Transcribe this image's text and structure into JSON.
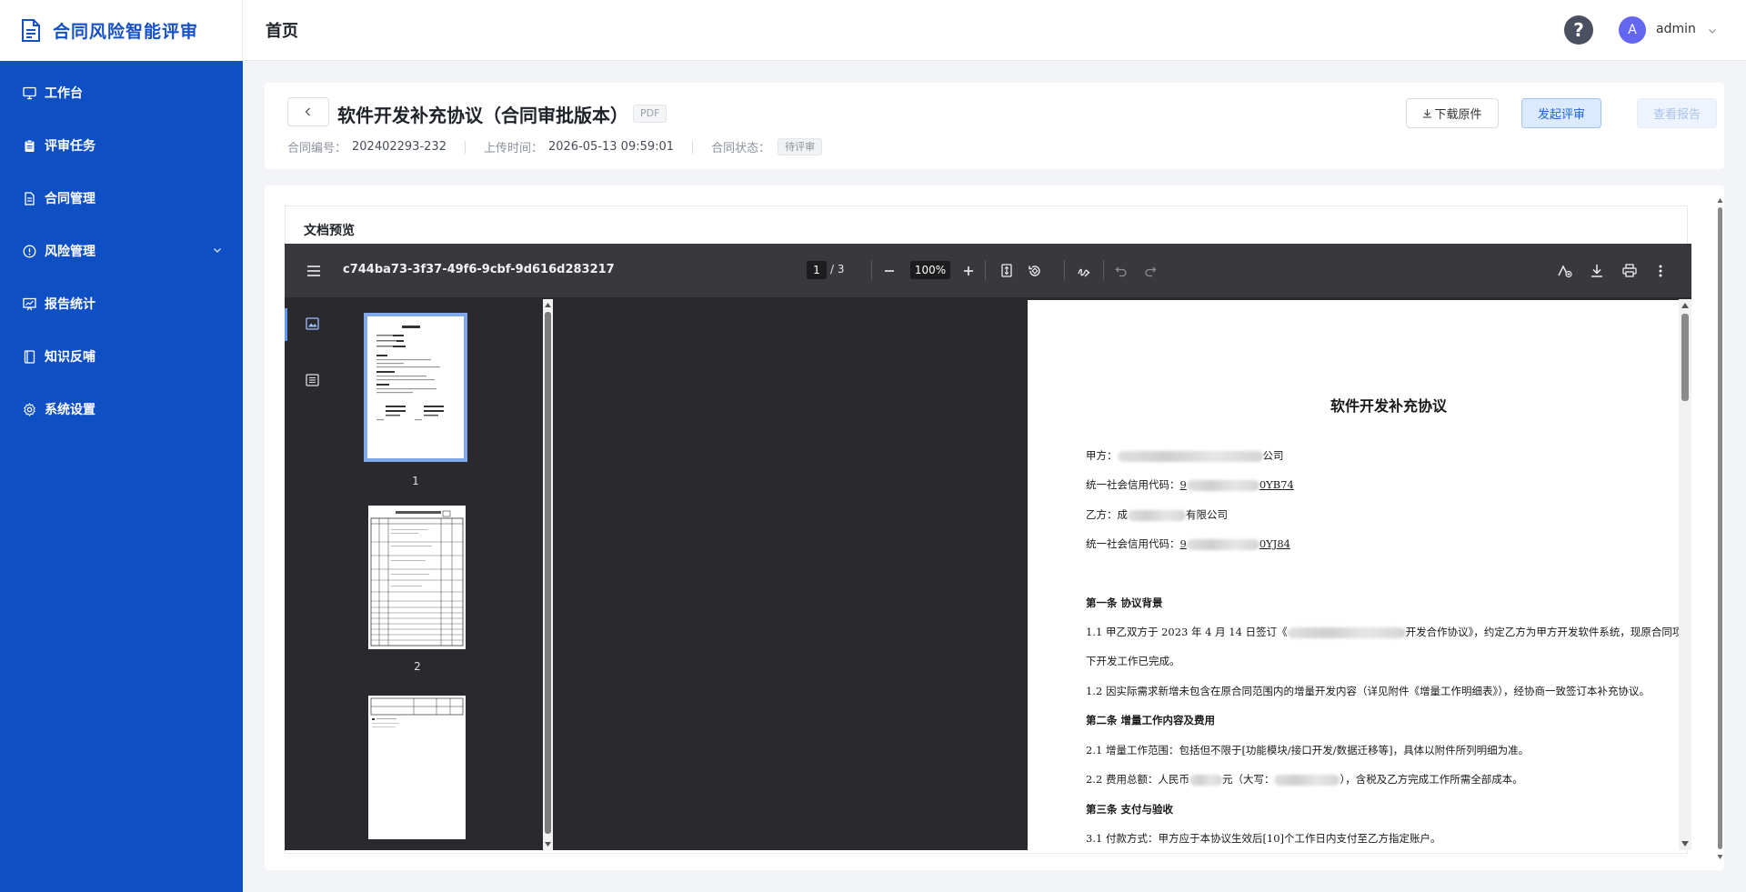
{
  "app": {
    "name": "合同风险智能评审"
  },
  "sidebar": {
    "items": [
      {
        "label": "工作台",
        "icon": "monitor-icon"
      },
      {
        "label": "评审任务",
        "icon": "clipboard-icon"
      },
      {
        "label": "合同管理",
        "icon": "document-icon"
      },
      {
        "label": "风险管理",
        "icon": "alert-circle-icon",
        "expandable": true
      },
      {
        "label": "报告统计",
        "icon": "chart-board-icon"
      },
      {
        "label": "知识反哺",
        "icon": "book-icon"
      },
      {
        "label": "系统设置",
        "icon": "gear-icon"
      }
    ]
  },
  "topbar": {
    "title": "首页",
    "avatar_letter": "A",
    "username": "admin"
  },
  "contract": {
    "title": "软件开发补充协议（合同审批版本）",
    "file_type": "PDF",
    "number_label": "合同编号：",
    "number": "202402293-232",
    "upload_label": "上传时间：",
    "upload_time": "2026-05-13 09:59:01",
    "status_label": "合同状态：",
    "status": "待评审",
    "download_label": "下载原件",
    "review_label": "发起评审",
    "report_label": "查看报告"
  },
  "preview": {
    "title": "文档预览"
  },
  "viewer": {
    "file_name": "c744ba73-3f37-49f6-9cbf-9d616d283217",
    "current_page": "1",
    "page_total": "/ 3",
    "zoom": "100%",
    "thumbnails": [
      "1",
      "2"
    ]
  },
  "document": {
    "title": "软件开发补充协议",
    "party_a": {
      "prefix": "甲方：",
      "suffix": "公司"
    },
    "credit_a": {
      "prefix": "统一社会信用代码：",
      "start": "9",
      "end": "0YB74"
    },
    "party_b": {
      "prefix": "乙方：",
      "start": "成",
      "suffix": "有限公司"
    },
    "credit_b": {
      "prefix": "统一社会信用代码：",
      "start": "9",
      "end": "0YJ84"
    },
    "sec1": "第一条  协议背景",
    "p1_1a": "1.1  甲乙双方于 2023 年 4 月 14 日签订《",
    "p1_1b": "开发合作协议》，约定乙方为甲方开发软件系统，现原合同项",
    "p1_1c": "下开发工作已完成。",
    "p1_2": "1.2  因实际需求新增未包含在原合同范围内的增量开发内容（详见附件《增量工作明细表》），经协商一致签订本补充协议。",
    "sec2": "第二条  增量工作内容及费用",
    "p2_1": "2.1  增量工作范围：包括但不限于[功能模块/接口开发/数据迁移等]，具体以附件所列明细为准。",
    "p2_2a": "2.2  费用总额：人民币",
    "p2_2b": "元（大写：",
    "p2_2c": "），含税及乙方完成工作所需全部成本。",
    "sec3": "第三条  支付与验收",
    "p3_1": "3.1  付款方式：甲方应于本协议生效后[10]个工作日内支付至乙方指定账户。"
  }
}
